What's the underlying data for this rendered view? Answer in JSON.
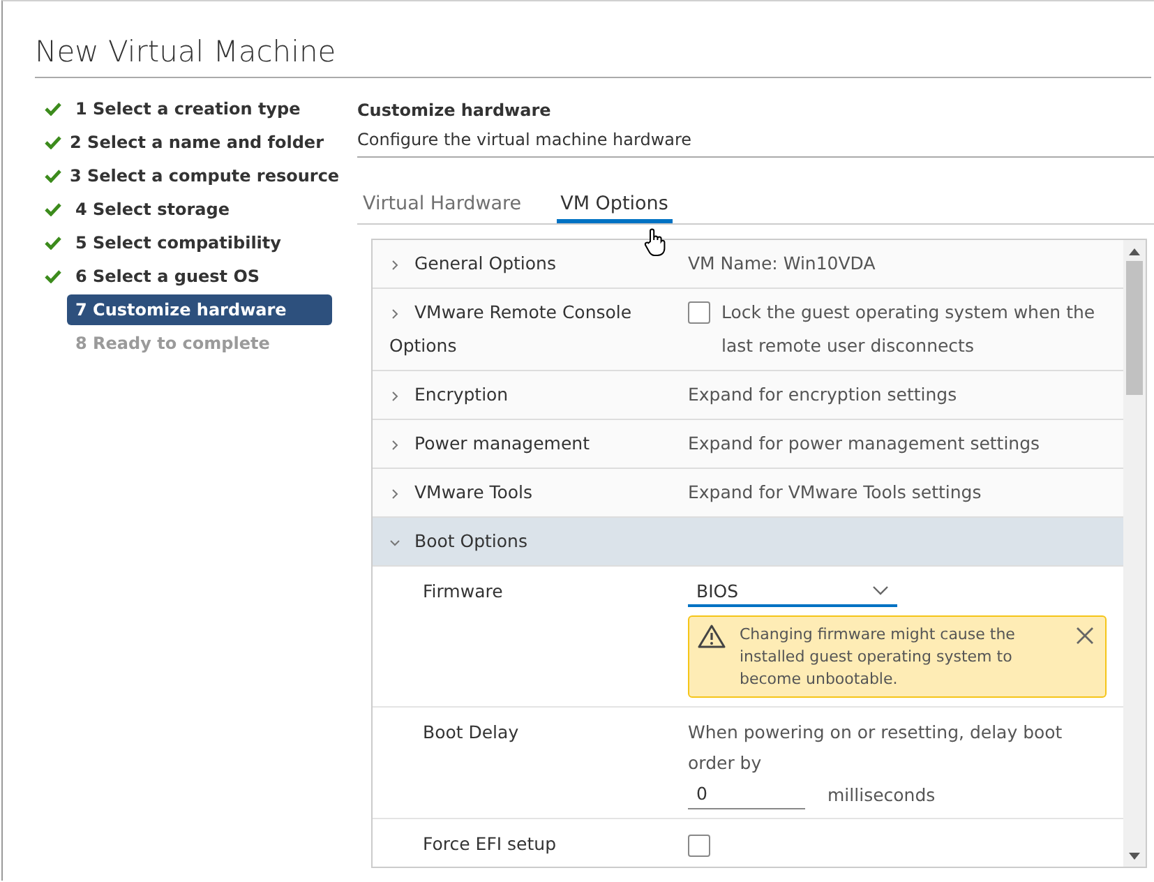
{
  "window": {
    "title": "New Virtual Machine"
  },
  "steps": [
    {
      "label": "1 Select a creation type",
      "completed": true,
      "selected": false
    },
    {
      "label": "2 Select a name and folder",
      "completed": true,
      "selected": false
    },
    {
      "label": "3 Select a compute resource",
      "completed": true,
      "selected": false
    },
    {
      "label": "4 Select storage",
      "completed": true,
      "selected": false
    },
    {
      "label": "5 Select compatibility",
      "completed": true,
      "selected": false
    },
    {
      "label": "6 Select a guest OS",
      "completed": true,
      "selected": false
    },
    {
      "label": "7 Customize hardware",
      "completed": false,
      "selected": true
    },
    {
      "label": "8 Ready to complete",
      "completed": false,
      "selected": false
    }
  ],
  "header": {
    "title": "Customize hardware",
    "subtitle": "Configure the virtual machine hardware"
  },
  "tabs": [
    {
      "label": "Virtual Hardware",
      "selected": false
    },
    {
      "label": "VM Options",
      "selected": true
    }
  ],
  "options": [
    {
      "label": "General Options",
      "expanded": false,
      "kind": "text",
      "value": "VM Name: Win10VDA"
    },
    {
      "label": "VMware Remote Console Options",
      "expanded": false,
      "kind": "checkbox",
      "checked": false,
      "value": "Lock the guest operating system when the last remote user disconnects"
    },
    {
      "label": "Encryption",
      "expanded": false,
      "kind": "text",
      "value": "Expand for encryption settings"
    },
    {
      "label": "Power management",
      "expanded": false,
      "kind": "text",
      "value": "Expand for power management settings"
    },
    {
      "label": "VMware Tools",
      "expanded": false,
      "kind": "text",
      "value": "Expand for VMware Tools settings"
    },
    {
      "label": "Boot Options",
      "expanded": true,
      "kind": "group",
      "children": [
        {
          "label": "Firmware",
          "kind": "select",
          "value": "BIOS",
          "warning": "Changing firmware might cause the installed guest operating system to become unbootable."
        },
        {
          "label": "Boot Delay",
          "kind": "number",
          "value": "When powering on or resetting, delay boot order by",
          "input": "0",
          "unit": "milliseconds"
        },
        {
          "label": "Force EFI setup",
          "kind": "checkbox",
          "checked": false
        }
      ]
    }
  ]
}
